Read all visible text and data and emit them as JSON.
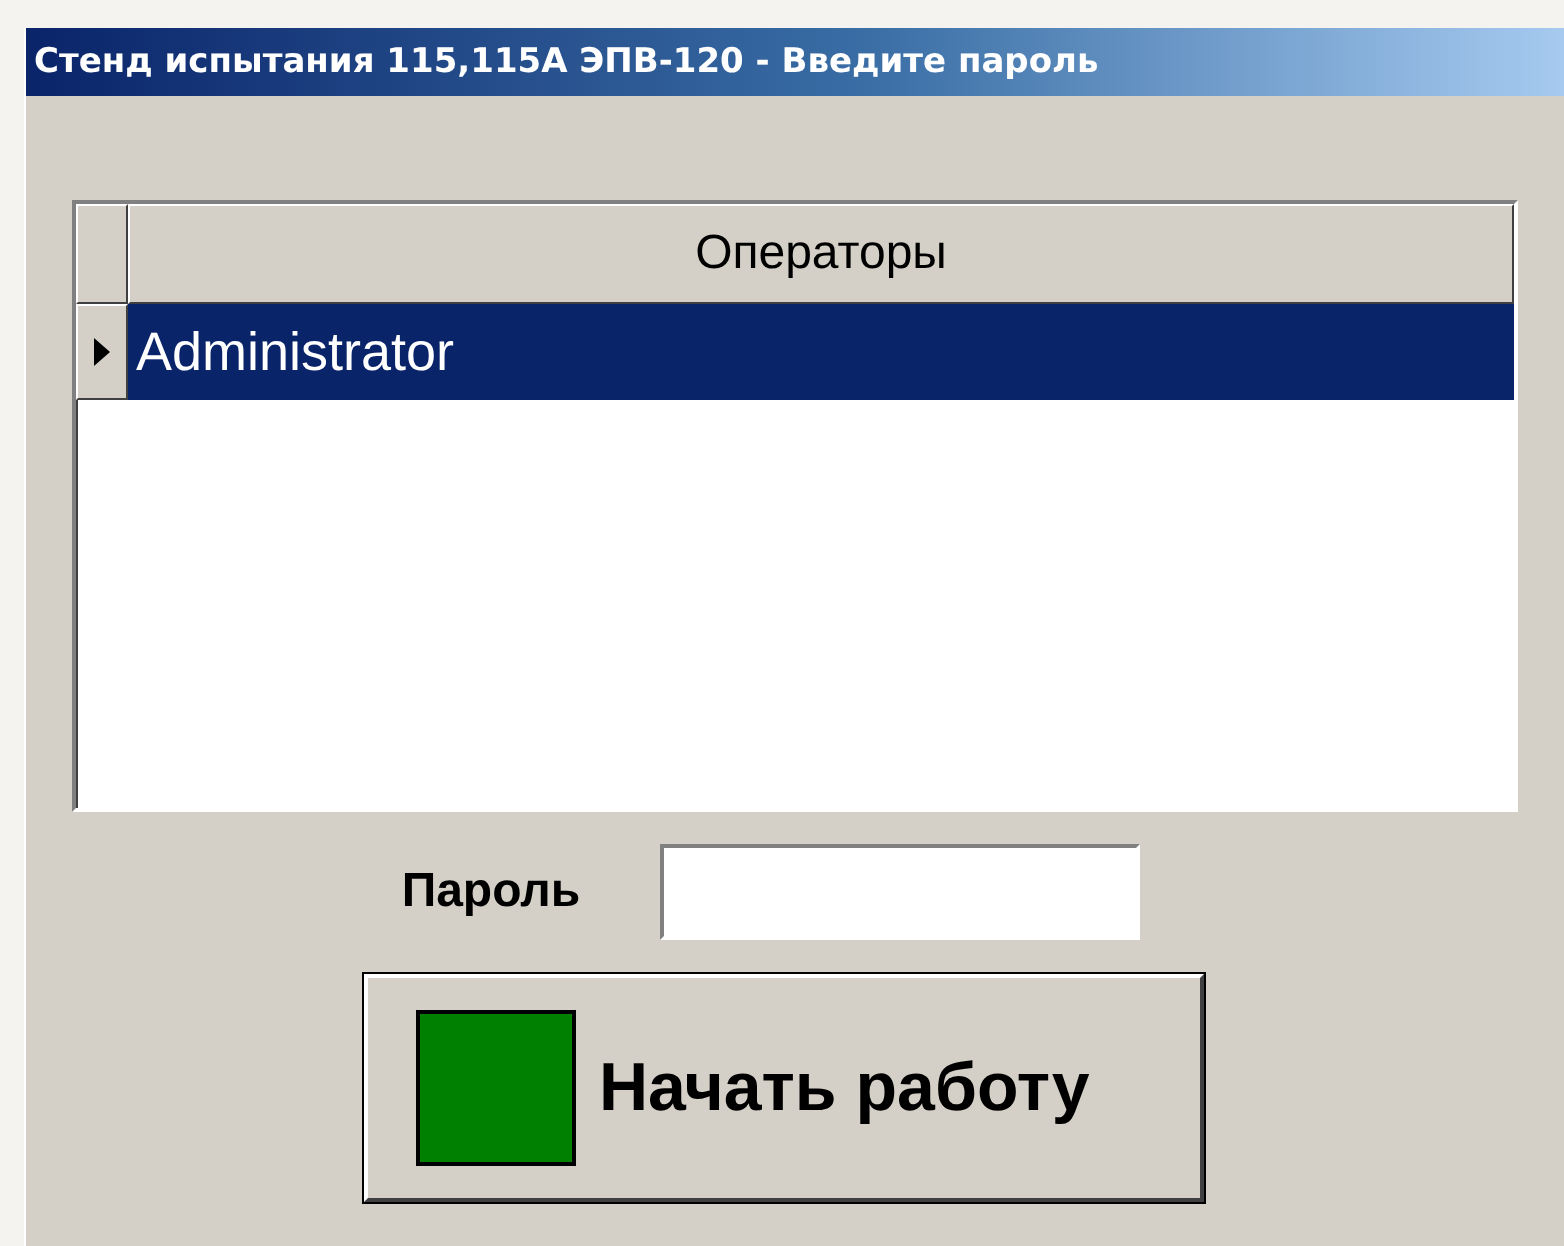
{
  "window": {
    "title": "Стенд испытания 115,115А ЭПВ-120 - Введите пароль"
  },
  "table": {
    "columns": [
      "Операторы"
    ],
    "rows": [
      {
        "name": "Administrator",
        "selected": true
      }
    ]
  },
  "password": {
    "label": "Пароль"
  },
  "start_button": {
    "label": "Начать работу"
  }
}
